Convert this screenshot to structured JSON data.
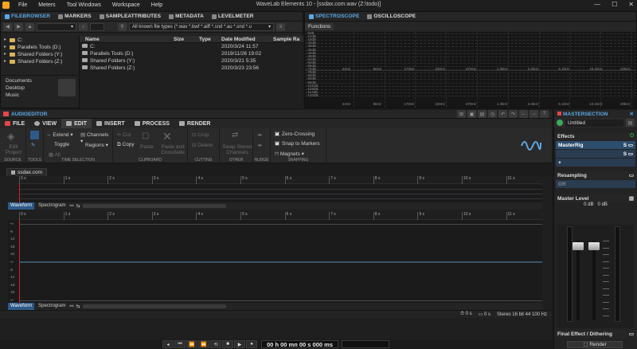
{
  "app": {
    "title": "WaveLab Elements 10 - [ssdax.com.wav (Z:\\todo)]",
    "menu": [
      "File",
      "Meters",
      "Tool Windows",
      "Workspace",
      "Help"
    ]
  },
  "top_tabs": {
    "left": [
      {
        "label": "FILEBROWSER",
        "active": true
      },
      {
        "label": "MARKERS"
      },
      {
        "label": "SAMPLEATTRIBUTES"
      },
      {
        "label": "METADATA"
      },
      {
        "label": "LEVELMETER"
      }
    ],
    "right": [
      {
        "label": "SPECTROSCOPE",
        "active": true
      },
      {
        "label": "OSCILLOSCOPE"
      }
    ]
  },
  "filebrowser": {
    "filter_placeholder": "All known file types (*.wav *.bwf *.aiff *.snd *.au *.snd *.u",
    "tree": [
      {
        "label": "C:"
      },
      {
        "label": "Parallels Tools (D:)"
      },
      {
        "label": "Shared Folders (Y:)"
      },
      {
        "label": "Shared Folders (Z:)"
      }
    ],
    "places": [
      "Documents",
      "Desktop",
      "Music"
    ],
    "columns": [
      "Name",
      "Size",
      "Type",
      "Date Modified",
      "Sample Ra"
    ],
    "rows": [
      {
        "name": "C:",
        "date": "2020/3/24 11:57"
      },
      {
        "name": "Parallels Tools (D:)",
        "date": "2019/11/26 19:02"
      },
      {
        "name": "Shared Folders (Y:)",
        "date": "2020/3/21 5:35"
      },
      {
        "name": "Shared Folders (Z:)",
        "date": "2020/3/23 23:56"
      }
    ]
  },
  "spectroscope": {
    "functions_label": "Functions",
    "db_labels": [
      "-6dB",
      "-12dB",
      "-18dB",
      "-24dB",
      "-30dB",
      "-36dB",
      "-42dB",
      "-48dB",
      "-54dB",
      "-60dB",
      "-66dB",
      "-72dB",
      "-78dB",
      "-84dB",
      "-90dB",
      "-96dB",
      "-102dB",
      "-108dB",
      "-114dB",
      "-120dB"
    ],
    "freq_labels": [
      "44Hz",
      "86Hz",
      "170Hz",
      "340Hz",
      "670Hz",
      "1.3kHz",
      "2.6kHz",
      "5.1kHz",
      "10.1kHz",
      "20kHz"
    ]
  },
  "audioeditor": {
    "header": "AUDIOEDITOR",
    "tabs": [
      "FILE",
      "VIEW",
      "EDIT",
      "INSERT",
      "PROCESS",
      "RENDER"
    ],
    "active_tab": "EDIT",
    "groups": [
      "SOURCE",
      "TOOLS",
      "TIME SELECTION",
      "CLIPBOARD",
      "CUTTING",
      "OTHER",
      "NUDGE",
      "SNAPPING"
    ],
    "source": {
      "edit_project": "Edit Project"
    },
    "time_selection": {
      "extend": "Extend",
      "channels": "Channels",
      "toggle": "Toggle",
      "regions": "Regions",
      "all": "All"
    },
    "clipboard": {
      "cut": "Cut",
      "copy": "Copy",
      "paste": "Paste",
      "paste_crossfade": "Paste and Crossfade"
    },
    "cutting": {
      "crop": "Crop",
      "delete": "Delete"
    },
    "other": {
      "swap": "Swap Stereo Channels"
    },
    "snapping": {
      "zero_crossing": "Zero-Crossing",
      "snap_markers": "Snap to Markers",
      "magnets": "Magnets"
    },
    "file_tab": "ssdax.com",
    "ruler_labels": [
      "0 s",
      "1 s",
      "2 s",
      "3 s",
      "4 s",
      "5 s",
      "6 s",
      "7 s",
      "8 s",
      "9 s",
      "10 s",
      "11 s"
    ],
    "view_tabs": {
      "waveform": "Waveform",
      "spectrogram": "Spectrogram"
    },
    "db_labels": [
      "-∞",
      "-6",
      "-12",
      "-18",
      "-24",
      "-∞",
      "-6",
      "-12",
      "-18",
      "-24",
      "-∞"
    ],
    "status": {
      "sel1": "0 s",
      "sel2": "0 s",
      "format": "Stereo 16 bit 44 100 Hz"
    }
  },
  "transport": {
    "time": "00 h 00 mn 00 s 000 ms"
  },
  "mastersection": {
    "header": "MASTERSECTION",
    "preset": "Untitled",
    "effects_label": "Effects",
    "slot1": "MasterRig",
    "resampling_label": "Resampling",
    "resampling_value": "Off",
    "master_level_label": "Master Level",
    "levels": [
      "0 dB",
      "0 dB"
    ],
    "final_label": "Final Effect / Dithering",
    "render_label": "Render"
  },
  "colors": {
    "accent": "#5aa9e6",
    "cursor": "#e0202a",
    "slot": "#2d4d6d"
  }
}
